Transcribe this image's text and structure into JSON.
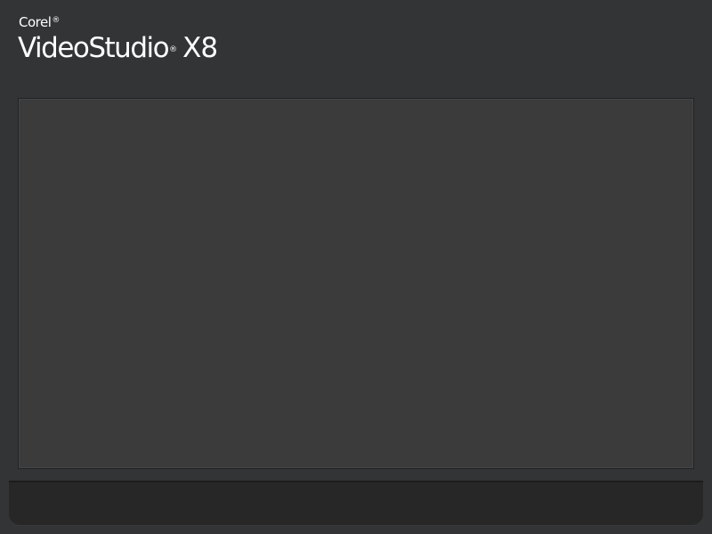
{
  "splash": {
    "brand": "Corel",
    "brand_mark": "®",
    "product": "VideoStudio",
    "product_mark": "®",
    "version": "X8"
  },
  "colors": {
    "background": "#333436",
    "preview": "#3b3b3b",
    "panel": "#272727",
    "text": "#ffffff"
  }
}
